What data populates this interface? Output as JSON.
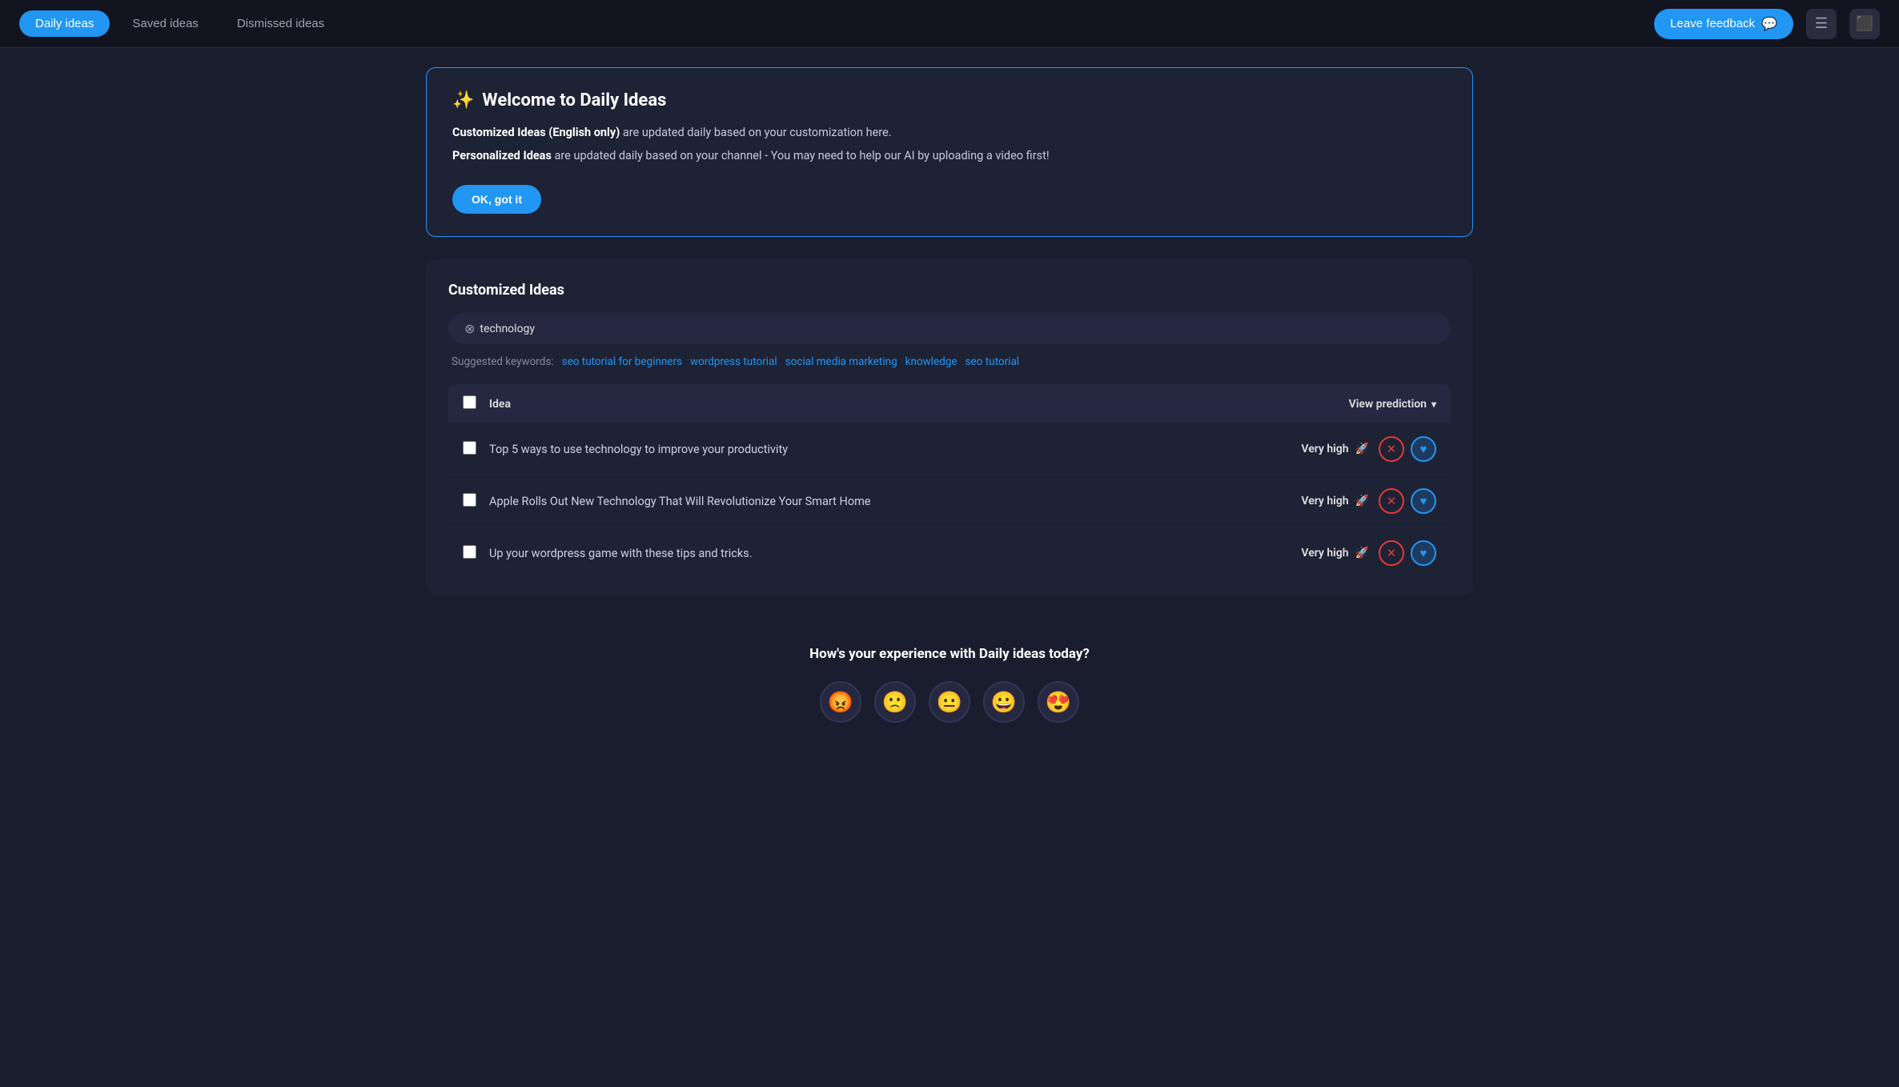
{
  "nav": {
    "tabs": [
      {
        "id": "daily",
        "label": "Daily ideas",
        "active": true
      },
      {
        "id": "saved",
        "label": "Saved ideas",
        "active": false
      },
      {
        "id": "dismissed",
        "label": "Dismissed ideas",
        "active": false
      }
    ],
    "feedback_button": "Leave feedback",
    "feedback_icon": "💬"
  },
  "welcome": {
    "icon": "✨",
    "title": "Welcome to Daily Ideas",
    "line1_bold": "Customized Ideas (English only)",
    "line1_rest": " are updated daily based on your customization here.",
    "line2_bold": "Personalized Ideas",
    "line2_rest": " are updated daily based on your channel - You may need to help our AI by uploading a video first!",
    "ok_button": "OK, got it"
  },
  "customized": {
    "section_title": "Customized Ideas",
    "keyword_tag": "technology",
    "suggested_label": "Suggested keywords:",
    "suggested_keywords": [
      "seo tutorial for beginners",
      "wordpress tutorial",
      "social media marketing",
      "knowledge",
      "seo tutorial"
    ],
    "table": {
      "header_idea": "Idea",
      "header_prediction": "View prediction",
      "rows": [
        {
          "idea": "Top 5 ways to use technology to improve your productivity",
          "prediction": "Very high",
          "prediction_icon": "🚀"
        },
        {
          "idea": "Apple Rolls Out New Technology That Will Revolutionize Your Smart Home",
          "prediction": "Very high",
          "prediction_icon": "🚀"
        },
        {
          "idea": "Up your wordpress game with these tips and tricks.",
          "prediction": "Very high",
          "prediction_icon": "🚀"
        }
      ]
    }
  },
  "feedback": {
    "question": "How's your experience with Daily ideas today?",
    "emojis": [
      "😡",
      "🙁",
      "😐",
      "😀",
      "😍"
    ]
  },
  "icons": {
    "list_icon": "☰",
    "monitor_icon": "🖥"
  }
}
